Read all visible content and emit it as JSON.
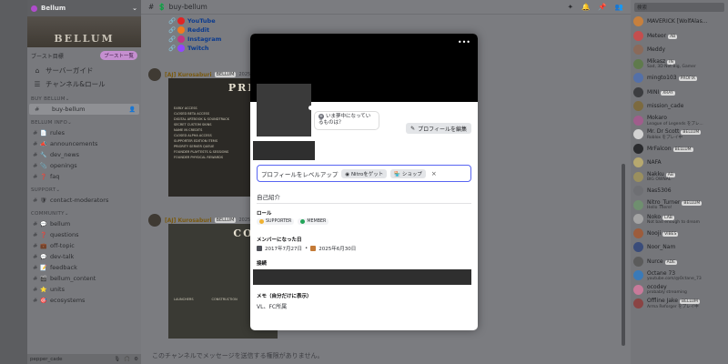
{
  "server": {
    "name": "Bellum",
    "banner_text": "BELLUM",
    "boost_label": "ブースト目標",
    "boost_pill": "ブースト一覧"
  },
  "sidebar": {
    "nav": [
      {
        "icon": "compass-icon",
        "label": "サーバーガイド"
      },
      {
        "icon": "roles-icon",
        "label": "チャンネル&ロール"
      }
    ],
    "categories": [
      {
        "name": "BUY BELLUM",
        "channels": [
          {
            "emoji": "",
            "name": "buy-bellum",
            "active": true
          }
        ]
      },
      {
        "name": "BELLUM INFO",
        "channels": [
          {
            "emoji": "📄",
            "name": "rules"
          },
          {
            "emoji": "📣",
            "name": "announcements"
          },
          {
            "emoji": "🔧",
            "name": "dev_news"
          },
          {
            "emoji": "📎",
            "name": "openings"
          },
          {
            "emoji": "❓",
            "name": "faq"
          }
        ]
      },
      {
        "name": "SUPPORT",
        "channels": [
          {
            "emoji": "🛡",
            "name": "contact-moderators"
          }
        ]
      },
      {
        "name": "COMMUNITY",
        "channels": [
          {
            "emoji": "💬",
            "name": "bellum"
          },
          {
            "emoji": "❓",
            "name": "questions"
          },
          {
            "emoji": "💼",
            "name": "off-topic"
          },
          {
            "emoji": "💬",
            "name": "dev-talk"
          },
          {
            "emoji": "📝",
            "name": "feedback"
          },
          {
            "emoji": "🎬",
            "name": "bellum_content"
          },
          {
            "emoji": "⭐",
            "name": "units"
          },
          {
            "emoji": "🎯",
            "name": "ecosystems"
          }
        ]
      }
    ],
    "user_name": "pepper_cade"
  },
  "main": {
    "channel_name": "buy-bellum",
    "links": [
      {
        "label": "YouTube",
        "color": "#e02424"
      },
      {
        "label": "Reddit",
        "color": "#f07a1f"
      },
      {
        "label": "Instagram",
        "color": "#c13584"
      },
      {
        "label": "Twitch",
        "color": "#9146ff"
      }
    ],
    "messages": [
      {
        "author": "[AJ] Kurosaburi",
        "bot_tag": "BELLUM",
        "time": "2025/06",
        "card_title": "PRE-O",
        "lines": [
          "EARLY ACCESS",
          "CLOSED BETA ACCESS",
          "DIGITAL ARTBOOK & SOUNDTRACK",
          "SECRET CUSTOM SKINS",
          "NAME IN CREDITS",
          "CLOSED ALPHA ACCESS",
          "SUPPORTER EDITION ITEMS",
          "PRIORITY SERVER QUEUE",
          "FOUNDER PLAYTESTS & SESSIONS",
          "FOUNDER PHYSICAL REWARDS"
        ]
      },
      {
        "author": "[AJ] Kurosaburi",
        "bot_tag": "BELLUM",
        "time": "2025/06",
        "card_title": "CONT",
        "lines": [
          "LAUNCHERS",
          "CONSTRUCTION"
        ]
      }
    ],
    "input_placeholder": "このチャンネルでメッセージを送信する権限がありません。"
  },
  "members": {
    "search_placeholder": "検索",
    "list": [
      {
        "name": "MAVERICK [WolfAlas...",
        "status": "",
        "tag": "",
        "color": "#c6803e"
      },
      {
        "name": "Meteor",
        "status": "",
        "tag": "AB",
        "color": "#c44e4e"
      },
      {
        "name": "Meddy",
        "status": "",
        "tag": "",
        "color": "#8a6a5a"
      },
      {
        "name": "Mikasz",
        "status": "Sad, 3D Not Big, Gamer",
        "tag": "IN",
        "color": "#5f7a4c"
      },
      {
        "name": "mingto103",
        "status": "",
        "tag": "PROFIX",
        "color": "#5470a8"
      },
      {
        "name": "MINI",
        "status": "",
        "tag": "XRAY",
        "color": "#3c3d40"
      },
      {
        "name": "mission_cade",
        "status": "",
        "tag": "",
        "color": "#7c6a3f"
      },
      {
        "name": "Mokaro",
        "status": "League of Legends をプレ...",
        "tag": "",
        "color": "#a05d8c"
      },
      {
        "name": "Mr. Dr Scott",
        "status": "Roblox をプレイ中",
        "tag": "BELLUM",
        "color": "#d2d2d2"
      },
      {
        "name": "MrFalcon",
        "status": "",
        "tag": "BELLUM",
        "color": "#2a2b2e"
      },
      {
        "name": "NAFA",
        "status": "",
        "tag": "",
        "color": "#b6a86f"
      },
      {
        "name": "Nakku",
        "status": "BIG OWNAL",
        "tag": "AB",
        "color": "#9a8f5e"
      },
      {
        "name": "Nas5306",
        "status": "",
        "tag": "",
        "color": "#6e6f73"
      },
      {
        "name": "Nitro_Turner",
        "status": "Hello There!",
        "tag": "BELLUM",
        "color": "#6f8f6f"
      },
      {
        "name": "Noko",
        "status": "Not bad enough to dream",
        "tag": "LAB",
        "color": "#a4a4a4"
      },
      {
        "name": "Nooji",
        "status": "",
        "tag": "VIBES",
        "color": "#9c5c3c"
      },
      {
        "name": "Noor_Nam",
        "status": "",
        "tag": "",
        "color": "#3a4c7a"
      },
      {
        "name": "Nurce",
        "status": "",
        "tag": "ADE",
        "color": "#5b5b5b"
      },
      {
        "name": "Octane 73",
        "status": "youtube.com/@Octane_73",
        "tag": "",
        "color": "#3a7ab8"
      },
      {
        "name": "ocodey",
        "status": "probably streaming",
        "tag": "",
        "color": "#c87a9a"
      },
      {
        "name": "Offline Jake",
        "status": "Arma Reforger をプレイ中",
        "tag": "BELLUM",
        "color": "#8a4444"
      }
    ]
  },
  "profile": {
    "more_label": "•••",
    "bubble_text": "いま夢中になっているものは？",
    "edit_label": "プロフィールを編集",
    "levelup_text": "プロフィールをレベルアップ",
    "nitro_chip": "Nitroをゲット",
    "shop_chip": "ショップ",
    "close_label": "×",
    "tab_label": "自己紹介",
    "roles_title": "ロール",
    "roles": [
      {
        "name": "SUPPORTER",
        "color": "#f0b232"
      },
      {
        "name": "MEMBER",
        "color": "#23a55a"
      }
    ],
    "since_title": "メンバーになった日",
    "discord_since": "2017年7月27日",
    "server_since": "2025年6月30日",
    "since_sep": "•",
    "connections_title": "接続",
    "note_title": "メモ（自分だけに表示）",
    "note_value": "VL、FC所属"
  }
}
